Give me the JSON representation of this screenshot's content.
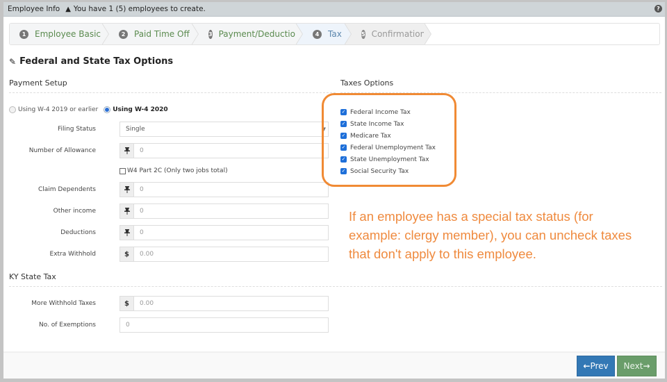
{
  "titlebar": {
    "title": "Employee Info",
    "warning_icon": "warning-triangle-icon",
    "warning_text": "You have 1 (5) employees to create.",
    "help_icon": "?"
  },
  "wizard": {
    "steps": [
      {
        "num": "1",
        "label": "Employee Basic",
        "state": "done"
      },
      {
        "num": "2",
        "label": "Paid Time Off",
        "state": "done"
      },
      {
        "num": "3",
        "label": "Payment/Deduction",
        "state": "done"
      },
      {
        "num": "4",
        "label": "Tax",
        "state": "active"
      },
      {
        "num": "5",
        "label": "Confirmation",
        "state": "disabled"
      }
    ]
  },
  "page": {
    "title_icon": "✎",
    "title": "Federal and State Tax Options"
  },
  "payment_setup": {
    "heading": "Payment Setup",
    "w4_options": [
      {
        "label": "Using W-4 2019 or earlier",
        "selected": false
      },
      {
        "label": "Using W-4 2020",
        "selected": true
      }
    ],
    "filing_status": {
      "label": "Filing Status",
      "value": "Single"
    },
    "allowance": {
      "label": "Number of Allowance",
      "addon": "⊥",
      "placeholder": "0"
    },
    "w4_part_2c": {
      "label": "W4 Part 2C (Only two jobs total)",
      "checked": false
    },
    "claim_dependents": {
      "label": "Claim Dependents",
      "addon": "⊥",
      "placeholder": "0"
    },
    "other_income": {
      "label": "Other income",
      "addon": "⊥",
      "placeholder": "0"
    },
    "deductions": {
      "label": "Deductions",
      "addon": "⊥",
      "placeholder": "0"
    },
    "extra_withhold": {
      "label": "Extra Withhold",
      "addon": "$",
      "placeholder": "0.00"
    }
  },
  "state_tax": {
    "heading": "KY State Tax",
    "more_withhold": {
      "label": "More Withhold Taxes",
      "addon": "$",
      "placeholder": "0.00"
    },
    "exemptions": {
      "label": "No. of Exemptions",
      "placeholder": "0"
    }
  },
  "taxes_options": {
    "heading": "Taxes Options",
    "items": [
      {
        "label": "Federal Income Tax",
        "checked": true
      },
      {
        "label": "State Income Tax",
        "checked": true
      },
      {
        "label": "Medicare Tax",
        "checked": true
      },
      {
        "label": "Federal Unemployment Tax",
        "checked": true
      },
      {
        "label": "State Unemployment Tax",
        "checked": true
      },
      {
        "label": "Social Security Tax",
        "checked": true
      }
    ]
  },
  "annotation": {
    "text": "If an employee has a special tax status (for example: clergy member), you can uncheck taxes that don't apply to this employee.",
    "color": "#ef8a3e"
  },
  "footer": {
    "prev_arrow": "🡐",
    "prev_label": "Prev",
    "next_label": "Next",
    "next_arrow": "🡒"
  },
  "colors": {
    "primary": "#3378b5",
    "success": "#6a9d6a",
    "highlight": "#f08a34"
  }
}
